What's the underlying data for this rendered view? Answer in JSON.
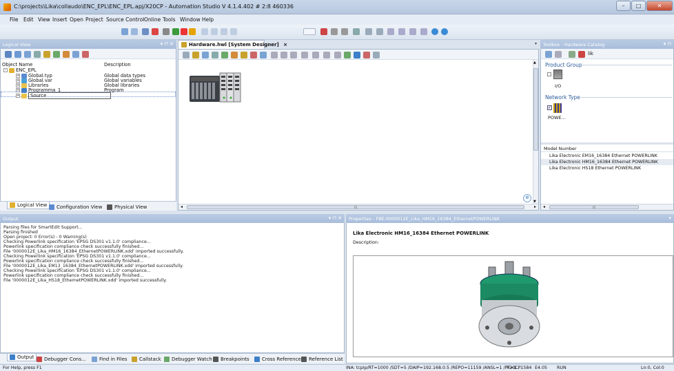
{
  "window": {
    "title": "C:\\projects\\Lika\\collaudo\\ENC_EPL\\ENC_EPL.apj/X20CP - Automation Studio V 4.1.4.402 # 2:8 460336"
  },
  "menu": [
    "File",
    "Edit",
    "View",
    "Insert",
    "Open",
    "Project",
    "Source Control",
    "Online",
    "Tools",
    "Window",
    "Help"
  ],
  "logical_view": {
    "header": "Logical View",
    "col_object": "Object Name",
    "col_desc": "Description",
    "tree": [
      {
        "name": "ENC_EPL",
        "desc": ""
      },
      {
        "name": "Global.typ",
        "desc": "Global data types"
      },
      {
        "name": "Global.var",
        "desc": "Global variables"
      },
      {
        "name": "Libraries",
        "desc": "Global libraries"
      },
      {
        "name": "Programma_1",
        "desc": "Program"
      },
      {
        "name": "Source",
        "desc": ""
      }
    ],
    "tabs": [
      "Logical View",
      "Configuration View",
      "Physical View"
    ]
  },
  "designer": {
    "tab_label": "Hardware.hwl [System Designer]",
    "close": "×",
    "hscroll_mark": "III"
  },
  "toolbox": {
    "header": "Toolbox - Hardware Catalog",
    "search_value": "lik",
    "product_group_label": "Product Group",
    "product_group_item": "I/O",
    "network_type_label": "Network Type",
    "network_type_item": "POWE...",
    "model_number_header": "Model Number",
    "models": [
      "Lika Electronic EM16_16384 Ethernet POWERLINK",
      "Lika Electronic HM16_16384 Ethernet POWERLINK",
      "Lika Electronic HS18 Ethernet POWERLINK"
    ],
    "hscroll_mark": "III"
  },
  "output": {
    "header": "Output",
    "lines": [
      "Parsing files for SmartEdit Support...",
      "Parsing finished",
      "Open project: 0 Error(s) - 0 Warning(s)",
      "Checking Powerlink specification 'EPSG DS301 v1.1.0' compliance...",
      "Powerlink specification compliance check successfully finished...",
      "File '0000012E_Lika_HM16_16384_EthernetPOWERLINK.xdd' imported successfully.",
      "Checking Powerlink specification 'EPSG DS301 v1.1.0' compliance...",
      "Powerlink specification compliance check successfully finished...",
      "File '0000012E_Lika_EM13_16384_EthernetPOWERLINK.xdd' imported successfully.",
      "Checking Powerlink specification 'EPSG DS301 v1.1.0' compliance...",
      "Powerlink specification compliance check successfully finished...",
      "File '0000012E_Lika_HS18_EthernetPOWERLINK.xdd' imported successfully."
    ],
    "tabs": [
      "Output",
      "Debugger Cons...",
      "Find in Files",
      "Callstack",
      "Debugger Watch",
      "Breakpoints",
      "Cross Reference",
      "Reference List"
    ]
  },
  "properties": {
    "header": "Properties - FBE.0000012E_Lika_HM16_16384_EthernetPOWERLINK",
    "title": "Lika Electronic HM16_16384 Ethernet POWERLINK",
    "description_label": "Description:"
  },
  "status": {
    "help": "For Help, press F1",
    "connection": "INA: tcpip/RT=1000 /SDT=5 /DAIP=192.168.0.5 /REPO=11159 /ANSL=1 /PT=1...",
    "cpu": "X20CP1584",
    "version": "E4.05",
    "mode": "RUN",
    "position": "Ln:0, Col:0"
  },
  "colors": {
    "panel_header": "#a9bedc",
    "accent_orange": "#f6a800",
    "encoder_green": "#1f9a6e"
  }
}
